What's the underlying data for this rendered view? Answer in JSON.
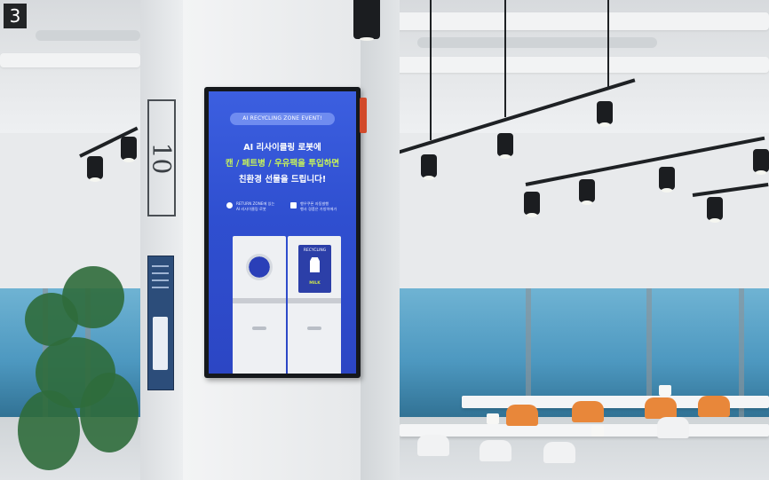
{
  "badge": {
    "number": "3"
  },
  "floor_sign": {
    "number": "10"
  },
  "display": {
    "event_label": "AI RECYCLING ZONE EVENT!",
    "headline": {
      "line1": "AI 리사이클링 로봇에",
      "line2": "캔 / 페트병 / 우유팩을 투입하면",
      "line3": "친환경 선물을 드립니다!"
    },
    "info_left": {
      "icon": "location-pin-icon",
      "line1": "RETURN ZONE에 있는",
      "line2": "AI 리사이클링 로봇"
    },
    "info_right": {
      "icon": "gift-icon",
      "line1": "행우쿠폰 자동발행",
      "line2": "행사 경품은 가방아에가"
    },
    "machine_panel": {
      "top_label": "RECYCLING",
      "icon": "milk-carton-icon",
      "bottom_label": "MILK"
    }
  },
  "colors": {
    "screen_blue": "#2f4fd0",
    "headline_accent": "#c6f25a",
    "chair_orange": "#e8873a",
    "window_blue": "#4d98c0"
  }
}
